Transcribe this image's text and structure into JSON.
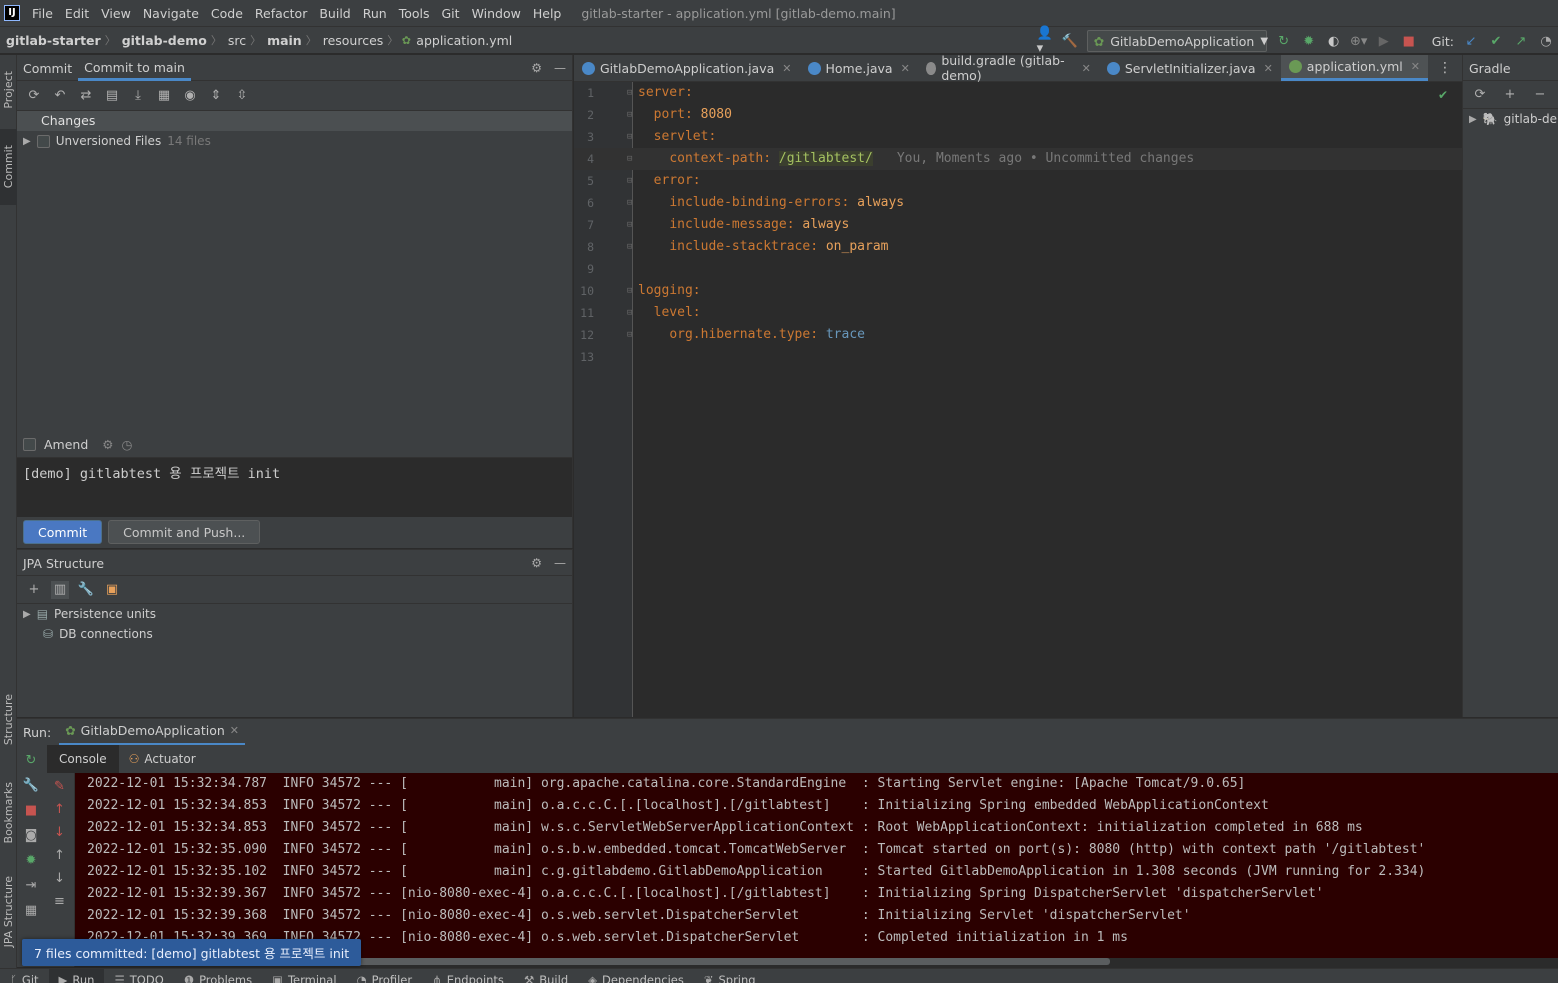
{
  "menubar": {
    "logo": "IJ",
    "items": [
      "File",
      "Edit",
      "View",
      "Navigate",
      "Code",
      "Refactor",
      "Build",
      "Run",
      "Tools",
      "Git",
      "Window",
      "Help"
    ],
    "window_title": "gitlab-starter - application.yml [gitlab-demo.main]"
  },
  "navbar": {
    "breadcrumbs": [
      "gitlab-starter",
      "gitlab-demo",
      "src",
      "main",
      "resources",
      "application.yml"
    ],
    "run_config": "GitlabDemoApplication",
    "git_label": "Git:"
  },
  "left_stripe": {
    "tabs": [
      "Project",
      "Commit",
      "Structure",
      "Bookmarks",
      "JPA Structure"
    ]
  },
  "commit_panel": {
    "tabs": [
      "Commit",
      "Commit to main"
    ],
    "changes_label": "Changes",
    "unversioned_label": "Unversioned Files",
    "unversioned_count": "14 files",
    "amend_label": "Amend",
    "commit_message": "[demo] gitlabtest 용 프로젝트 init",
    "commit_button": "Commit",
    "commit_push_button": "Commit and Push..."
  },
  "jpa_panel": {
    "title": "JPA Structure",
    "items": [
      "Persistence units",
      "DB connections"
    ]
  },
  "editor": {
    "tabs": [
      {
        "label": "GitlabDemoApplication.java",
        "icon_color": "#4a88c7",
        "active": false
      },
      {
        "label": "Home.java",
        "icon_color": "#4a88c7",
        "active": false
      },
      {
        "label": "build.gradle (gitlab-demo)",
        "icon_color": "#8a8a8a",
        "active": false
      },
      {
        "label": "ServletInitializer.java",
        "icon_color": "#4a88c7",
        "active": false
      },
      {
        "label": "application.yml",
        "icon_color": "#6a9955",
        "active": true
      }
    ],
    "lines": [
      {
        "n": "1",
        "indent": "",
        "key": "server",
        "sep": ":",
        "val": "",
        "val_class": ""
      },
      {
        "n": "2",
        "indent": "  ",
        "key": "port",
        "sep": ": ",
        "val": "8080",
        "val_class": "val-orange"
      },
      {
        "n": "3",
        "indent": "  ",
        "key": "servlet",
        "sep": ":",
        "val": "",
        "val_class": ""
      },
      {
        "n": "4",
        "indent": "    ",
        "key": "context-path",
        "sep": ": ",
        "val": "/gitlabtest/",
        "val_class": "val-green"
      },
      {
        "n": "5",
        "indent": "  ",
        "key": "error",
        "sep": ":",
        "val": "",
        "val_class": ""
      },
      {
        "n": "6",
        "indent": "    ",
        "key": "include-binding-errors",
        "sep": ": ",
        "val": "always",
        "val_class": "val-orange"
      },
      {
        "n": "7",
        "indent": "    ",
        "key": "include-message",
        "sep": ": ",
        "val": "always",
        "val_class": "val-orange"
      },
      {
        "n": "8",
        "indent": "    ",
        "key": "include-stacktrace",
        "sep": ": ",
        "val": "on_param",
        "val_class": "val-orange"
      },
      {
        "n": "9",
        "indent": "",
        "key": "",
        "sep": "",
        "val": "",
        "val_class": ""
      },
      {
        "n": "10",
        "indent": "",
        "key": "logging",
        "sep": ":",
        "val": "",
        "val_class": ""
      },
      {
        "n": "11",
        "indent": "  ",
        "key": "level",
        "sep": ":",
        "val": "",
        "val_class": ""
      },
      {
        "n": "12",
        "indent": "    ",
        "key": "org.hibernate.type",
        "sep": ": ",
        "val": "trace",
        "val_class": "val-blue"
      },
      {
        "n": "13",
        "indent": "",
        "key": "",
        "sep": "",
        "val": "",
        "val_class": ""
      }
    ],
    "blame": "You, Moments ago • Uncommitted changes"
  },
  "gradle_panel": {
    "title": "Gradle",
    "project": "gitlab-demo"
  },
  "run_panel": {
    "label": "Run:",
    "config_tab": "GitlabDemoApplication",
    "sub_tabs": [
      "Console",
      "Actuator"
    ],
    "log_lines": [
      "2022-12-01 15:32:34.787  INFO 34572 --- [           main] org.apache.catalina.core.StandardEngine  : Starting Servlet engine: [Apache Tomcat/9.0.65]",
      "2022-12-01 15:32:34.853  INFO 34572 --- [           main] o.a.c.c.C.[.[localhost].[/gitlabtest]    : Initializing Spring embedded WebApplicationContext",
      "2022-12-01 15:32:34.853  INFO 34572 --- [           main] w.s.c.ServletWebServerApplicationContext : Root WebApplicationContext: initialization completed in 688 ms",
      "2022-12-01 15:32:35.090  INFO 34572 --- [           main] o.s.b.w.embedded.tomcat.TomcatWebServer  : Tomcat started on port(s): 8080 (http) with context path '/gitlabtest'",
      "2022-12-01 15:32:35.102  INFO 34572 --- [           main] c.g.gitlabdemo.GitlabDemoApplication     : Started GitlabDemoApplication in 1.308 seconds (JVM running for 2.334)",
      "2022-12-01 15:32:39.367  INFO 34572 --- [nio-8080-exec-4] o.a.c.c.C.[.[localhost].[/gitlabtest]    : Initializing Spring DispatcherServlet 'dispatcherServlet'",
      "2022-12-01 15:32:39.368  INFO 34572 --- [nio-8080-exec-4] o.s.web.servlet.DispatcherServlet        : Initializing Servlet 'dispatcherServlet'",
      "2022-12-01 15:32:39.369  INFO 34572 --- [nio-8080-exec-4] o.s.web.servlet.DispatcherServlet        : Completed initialization in 1 ms"
    ]
  },
  "toast": {
    "message": "7 files committed: [demo] gitlabtest 용 프로젝트 init"
  },
  "bottom_bar": {
    "tabs": [
      "Git",
      "Run",
      "TODO",
      "Problems",
      "Terminal",
      "Profiler",
      "Endpoints",
      "Build",
      "Dependencies",
      "Spring"
    ]
  }
}
